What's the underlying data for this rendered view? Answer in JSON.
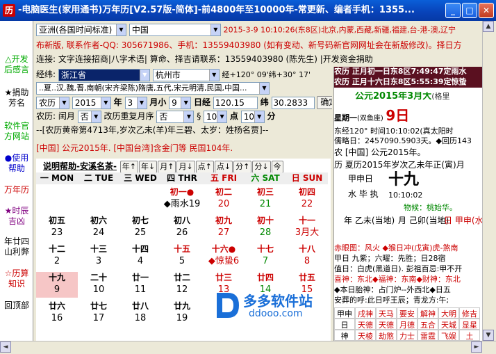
{
  "window": {
    "title": "-电脑医生(家用通书)万年历[V2.57版-简体]-前4800年至10000年-常更新、编者手机：1355...",
    "icon": "历"
  },
  "left_nav": [
    "△开发后感言",
    "★捐助芳名",
    "软件官方网站",
    "●使用帮助",
    "万年历",
    "★时辰吉凶",
    "年廿四山利弊",
    "☆历算知识",
    "回顶部"
  ],
  "top": {
    "timezone": "亚洲(各国时间标准)",
    "country": "中国",
    "now_text": "2015-3-9 10:10:26(东8区)北京,内蒙,西藏,新疆,福建,台-港-澳,辽宁",
    "notice": "布新版, 联系作者-QQ: 305671986、手机：13559403980 (如有变动、新号码新官网网址会在新版修改)。择日方",
    "contact": "连接: 文字连接招商|八字术语| 算命、择吉请联系：13559403980 (陈先生) |开发资金捐助"
  },
  "location": {
    "label_jw": "经纬:",
    "province": "浙江省",
    "city": "杭州市",
    "coords": "经+120°  09'纬+30° 17'",
    "dynasty": "..夏..汉,魏,晋,南朝(宋齐梁陈)隋唐,五代,宋元明清,民国,中国..."
  },
  "date_row": {
    "cal_type": "农历",
    "year": "2015",
    "year_label": "年",
    "month": "3",
    "month_label": "月小",
    "day": "9",
    "day_label": "日",
    "jing_label": "经",
    "lng": "120.15",
    "wei_label": "纬",
    "lat": "30.2833",
    "ok": "确定"
  },
  "lunar_row": {
    "label": "农历:",
    "run_label": "闰月",
    "run_val": "否",
    "mode_label": "改历重复月序",
    "mode_val": "否",
    "hour_val": "10",
    "min_label": "点",
    "min_val": "10",
    "sec_label": "分",
    "sect": "§"
  },
  "ganzhi_line": "--[农历黄帝第4713年,岁次乙未(羊)年三碧、太岁：姓杨名贾]--",
  "era_line": "[中国] 公元2015年. [中国台湾]含金门等 民国104年.",
  "cal": {
    "help": "说明帮助-安溪名茶-",
    "nav": [
      "年↑",
      "年↓",
      "月↑",
      "月↓",
      "点↑",
      "点↓",
      "分↑",
      "分↓",
      "今"
    ],
    "weekdays": [
      "一 MON",
      "二 TUE",
      "三 WED",
      "四 THR",
      "五 FRI",
      "六 SAT",
      "日 SUN"
    ],
    "rows": [
      [
        [
          "",
          ""
        ],
        [
          "",
          ""
        ],
        [
          "",
          ""
        ],
        [
          "初一●",
          "◆雨水19"
        ],
        [
          "初二",
          "20"
        ],
        [
          "初三",
          "21"
        ],
        [
          "初四",
          "22"
        ]
      ],
      [
        [
          "初五",
          "23"
        ],
        [
          "初六",
          "24"
        ],
        [
          "初七",
          "25"
        ],
        [
          "初八",
          "26"
        ],
        [
          "初九",
          "27"
        ],
        [
          "初十",
          "28"
        ],
        [
          "十一",
          "3月大"
        ]
      ],
      [
        [
          "十二",
          "2"
        ],
        [
          "十三",
          "3"
        ],
        [
          "十四",
          "4"
        ],
        [
          "十五",
          "5"
        ],
        [
          "十六●",
          "◆惊蛰6"
        ],
        [
          "十七",
          "7"
        ],
        [
          "十八",
          "8"
        ]
      ],
      [
        [
          "十九",
          "9"
        ],
        [
          "二十",
          "10"
        ],
        [
          "廿一",
          "11"
        ],
        [
          "廿二",
          "12"
        ],
        [
          "廿三",
          "13"
        ],
        [
          "廿四",
          "14"
        ],
        [
          "廿五",
          "15"
        ]
      ],
      [
        [
          "廿六",
          "16"
        ],
        [
          "廿七",
          "17"
        ],
        [
          "廿八",
          "18"
        ],
        [
          "廿九",
          "19"
        ],
        [
          "",
          ""
        ],
        [
          "",
          ""
        ],
        [
          "",
          ""
        ]
      ]
    ]
  },
  "right": {
    "jieqi1": "农历 正月初一日东8区7:49:47定雨水",
    "jieqi2": "农历 正月十六日东8区5:55:39定惊蛰",
    "head": "公元2015年3月大",
    "head_note": "(格里",
    "weekday": "星期一",
    "star": "(双鱼座)",
    "day": "9日",
    "dongjing": "东经120° 时间10:10:02(真太阳时",
    "julian": "儒略日：2457090.5903天。◆回历143",
    "nong1": "农 [中国] 公元2015年。",
    "li1": "历 夏历2015年岁次乙未年正(寅)月",
    "jiazi": "甲申日",
    "big": "十九",
    "shui": "水 毕 执",
    "time": "10:10:02",
    "wuxing": "物候：桃始华。",
    "pillars": [
      "年 乙未(当地)",
      "月 己卯(当地)",
      "日 甲申(水)",
      "时 10:10日"
    ],
    "lines": [
      "赤眼图：风火 ◆猴日冲(戊寅)虎-煞南",
      "甲日 九紫；六曜：先胜；日28宿",
      "值日：白虎(黑道日). 彭祖百忌:甲不开",
      "喜神：东北◆福神：东南◆财神：东北",
      "◆本日胎神：占门炉--外西北◆日五",
      "安葬的呼:此日呼王辰；青龙方:午;"
    ],
    "grid": [
      "甲申",
      "戌神",
      "天马",
      "要安",
      "解神",
      "大明",
      "修吉",
      "日",
      "天德",
      "天德",
      "月德",
      "五合",
      "天城",
      "显星",
      "神",
      "天棱",
      "劫煞",
      "力士",
      "雷霆",
      "飞娱",
      "土"
    ]
  },
  "watermark": {
    "brand": "多多软件站",
    "url": "ddooo.com"
  },
  "colors": {
    "title_bar": "#0842b8",
    "accent_red": "#cc0000",
    "header_dark": "#5a1020"
  }
}
